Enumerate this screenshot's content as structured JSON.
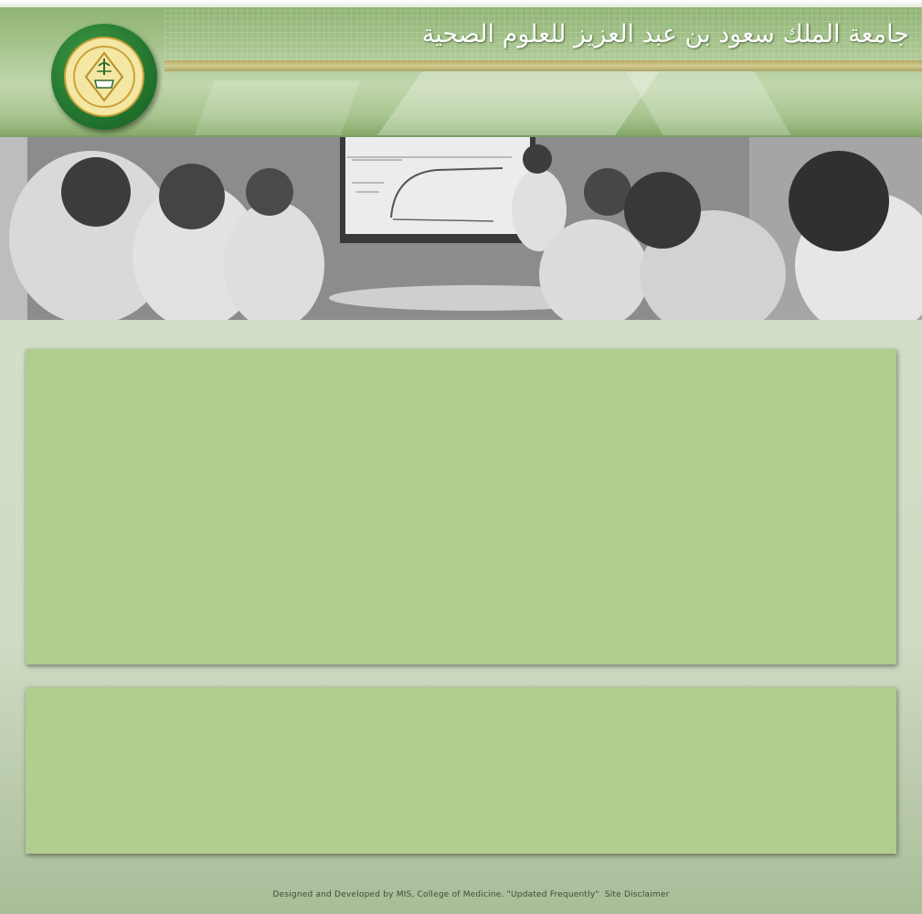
{
  "header": {
    "title": "جامعة الملك سعود بن عبد العزيز للعلوم الصحية",
    "logo_icon": "university-seal-icon"
  },
  "banner": {
    "image": "students-classroom-photo"
  },
  "footer": {
    "credit": "Designed and Developed by MIS, College of Medicine.",
    "update_note": "\"Updated Frequently\"",
    "disclaimer_link": "Site Disclaimer"
  },
  "colors": {
    "header_green": "#a6c48c",
    "panel_green": "#b1cd90",
    "seal_green": "#1f6f2a",
    "seal_gold": "#c9a33b"
  }
}
